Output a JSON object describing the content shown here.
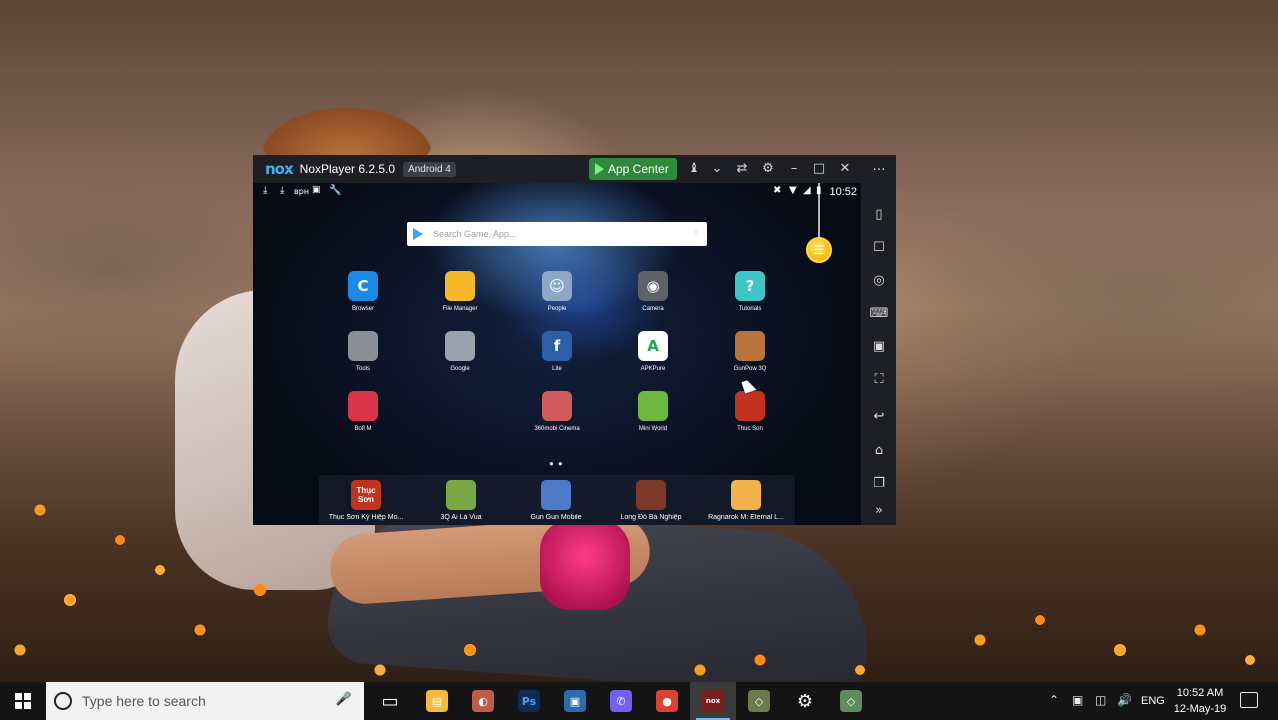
{
  "nox": {
    "logo": "nox",
    "title": "NoxPlayer 6.2.5.0",
    "badge": "Android 4",
    "app_center": "App Center",
    "titlebar_icons": [
      "shirt-icon",
      "chevron-down-icon",
      "pin-icon",
      "gear-icon",
      "minimize-icon",
      "maximize-icon",
      "close-icon"
    ],
    "sidebar_icons": [
      "more-icon",
      "shake-icon",
      "robot-icon",
      "location-icon",
      "keyboard-icon",
      "apk-icon",
      "fullscreen-icon",
      "back-icon",
      "home-icon",
      "recent-apps-icon",
      "expand-icon"
    ]
  },
  "android": {
    "status_left": [
      "download-icon",
      "download-icon",
      "vpn-text",
      "flag-icon",
      "wrench-icon"
    ],
    "vpn_text": "врн",
    "time": "10:52",
    "search_placeholder": "Search Game, App...",
    "apps": [
      {
        "label": "Browser",
        "color": "#1e88e5",
        "glyph": "C"
      },
      {
        "label": "File Manager",
        "color": "#f6b92b",
        "glyph": ""
      },
      {
        "label": "People",
        "color": "#8fa7c7",
        "glyph": "☺"
      },
      {
        "label": "Camera",
        "color": "#5f6369",
        "glyph": "◉"
      },
      {
        "label": "Tutorials",
        "color": "#3cc6c6",
        "glyph": "?"
      },
      {
        "label": "Tools",
        "color": "#8a8f98",
        "glyph": ""
      },
      {
        "label": "Google",
        "color": "#9aa3ad",
        "glyph": ""
      },
      {
        "label": "Lite",
        "color": "#2d5ea8",
        "glyph": "f"
      },
      {
        "label": "APKPure",
        "color": "#ffffff",
        "glyph": "A"
      },
      {
        "label": "GunPow 3Q",
        "color": "#b8743a",
        "glyph": ""
      },
      {
        "label": "Bofl M",
        "color": "#d9344a",
        "glyph": ""
      },
      {
        "label": "360mobi Cinema",
        "color": "#d15a5a",
        "glyph": ""
      },
      {
        "label": "Mini World",
        "color": "#6fb83f",
        "glyph": ""
      },
      {
        "label": "Thuc Son",
        "color": "#c2331f",
        "glyph": ""
      }
    ],
    "dock": [
      {
        "label": "Thục Sơn Kỳ Hiệp Mo...",
        "color": "#c2331f",
        "glyph": "Thục Sơn"
      },
      {
        "label": "3Q Ai Là Vua",
        "color": "#7aa843",
        "glyph": ""
      },
      {
        "label": "Gun Gun Mobile",
        "color": "#4f79c9",
        "glyph": ""
      },
      {
        "label": "Long Đồ Bá Nghiệp",
        "color": "#7a3a27",
        "glyph": ""
      },
      {
        "label": "Ragnarok M: Eternal L...",
        "color": "#f1b34a",
        "glyph": ""
      }
    ]
  },
  "taskbar": {
    "search_placeholder": "Type here to search",
    "apps": [
      {
        "name": "task-view",
        "color": "#141414",
        "glyph": "▭"
      },
      {
        "name": "file-explorer",
        "color": "#f2bb3a",
        "glyph": "▤"
      },
      {
        "name": "paint-app",
        "color": "#c05b4a",
        "glyph": "◐"
      },
      {
        "name": "photoshop",
        "color": "#0d2a52",
        "glyph": "Ps"
      },
      {
        "name": "monitor-app",
        "color": "#2b6cb0",
        "glyph": "▣"
      },
      {
        "name": "viber",
        "color": "#7360f2",
        "glyph": "✆"
      },
      {
        "name": "chrome",
        "color": "#d9432f",
        "glyph": "●"
      },
      {
        "name": "noxplayer",
        "color": "#7a1d1d",
        "glyph": "nox"
      },
      {
        "name": "game-app",
        "color": "#6d7a4a",
        "glyph": "◇"
      },
      {
        "name": "settings",
        "color": "#141414",
        "glyph": "⚙"
      },
      {
        "name": "game-app-2",
        "color": "#5c8c5a",
        "glyph": "◇"
      }
    ],
    "lang": "ENG",
    "time": "10:52 AM",
    "date": "12-May-19"
  }
}
